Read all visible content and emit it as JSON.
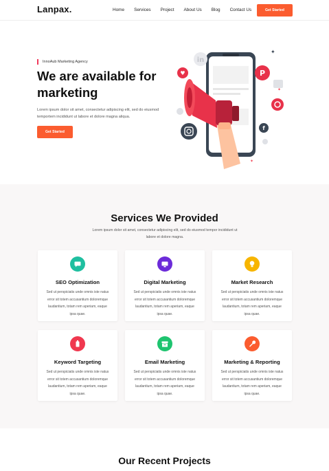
{
  "header": {
    "logo": "Lanpax.",
    "nav": [
      "Home",
      "Services",
      "Project",
      "About Us",
      "Blog",
      "Contact Us"
    ],
    "cta": "Get Started"
  },
  "hero": {
    "tagline": "InnoAub Marketing Agency",
    "title": "We are available for marketing",
    "text": "Lorem ipsum dolor sit amet, consectetur adipiscing elit, sed do eiusmod temportem incididunt ut labore et dolore magna aliqua.",
    "cta": "Get Started"
  },
  "services": {
    "title": "Services We Provided",
    "subtitle": "Lorem ipsum dolor sit amet, consectetur adipiscing elit, sed do eiusmod tempor incididunt ut labore et dolore magna.",
    "cards": [
      {
        "title": "SEO Optimization",
        "desc": "Sed ut perspiciatis unde omnis iste natus error sit totem accusantium doloremque laudantium, totam rem aperiam, eaque ipsa quae.",
        "icon": "chat-icon",
        "color": "#1fbfa0"
      },
      {
        "title": "Digital Marketing",
        "desc": "Sed ut perspiciatis unde omnis iste natus error sit totem accusantium doloremque laudantium, totam rem aperiam, eaque ipsa quae.",
        "icon": "monitor-icon",
        "color": "#6c2bd9"
      },
      {
        "title": "Market Research",
        "desc": "Sed ut perspiciatis unde omnis iste natus error sit totem accusantium doloremque laudantium, totam rem aperiam, eaque ipsa quae.",
        "icon": "bulb-icon",
        "color": "#f7b500"
      },
      {
        "title": "Keyword Targeting",
        "desc": "Sed ut perspiciatis unde omnis iste natus error sit totem accusantium doloremque laudantium, totam rem aperiam, eaque ipsa quae.",
        "icon": "battery-icon",
        "color": "#f0384f"
      },
      {
        "title": "Email Marketing",
        "desc": "Sed ut perspiciatis unde omnis iste natus error sit totem accusantium doloremque laudantium, totam rem aperiam, eaque ipsa quae.",
        "icon": "archive-icon",
        "color": "#1ec46f"
      },
      {
        "title": "Marketing & Reporting",
        "desc": "Sed ut perspiciatis unde omnis iste natus error sit totem accusantium doloremque laudantium, totam rem aperiam, eaque ipsa quae.",
        "icon": "wrench-icon",
        "color": "#fb5c2f"
      }
    ]
  },
  "projects": {
    "title": "Our Recent Projects"
  }
}
